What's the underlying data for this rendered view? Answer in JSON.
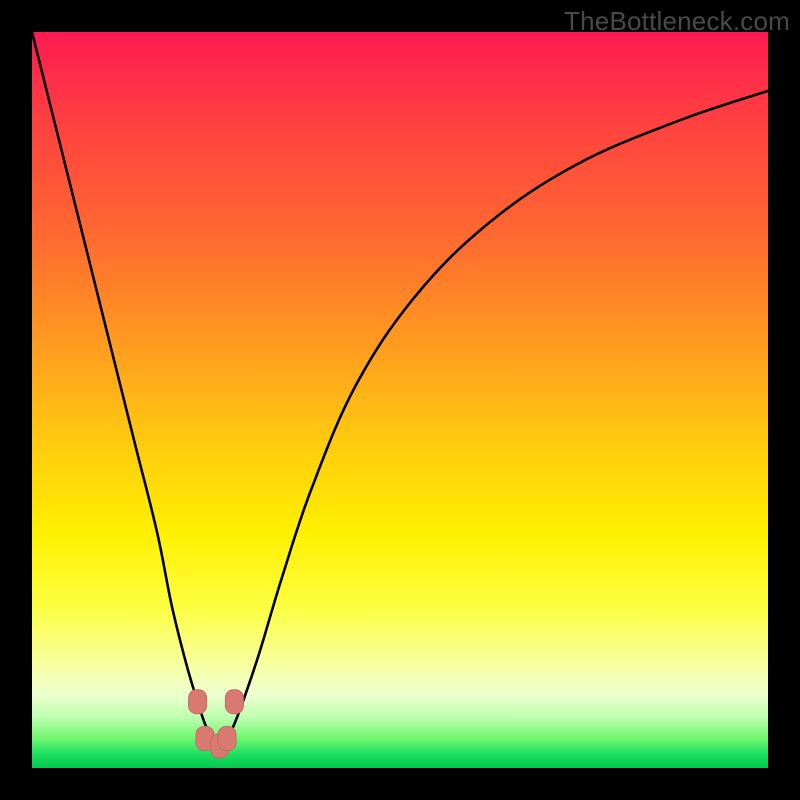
{
  "watermark": {
    "text": "TheBottleneck.com"
  },
  "colors": {
    "curve_stroke": "#000000",
    "marker_fill": "#d97a72",
    "marker_stroke": "#c86a62"
  },
  "chart_data": {
    "type": "line",
    "title": "",
    "xlabel": "",
    "ylabel": "",
    "xlim": [
      0,
      100
    ],
    "ylim": [
      0,
      100
    ],
    "grid": false,
    "legend": false,
    "series": [
      {
        "name": "bottleneck-curve",
        "x": [
          0,
          2,
          5,
          8,
          11,
          14,
          17,
          19,
          21,
          22.5,
          23.5,
          24.5,
          25.5,
          26.5,
          27.5,
          29,
          31,
          34,
          38,
          44,
          52,
          62,
          74,
          88,
          100
        ],
        "y": [
          100,
          92,
          80,
          68,
          56,
          44,
          32,
          22,
          14,
          9,
          6,
          4,
          3,
          4,
          6,
          10,
          16,
          26,
          38,
          52,
          64,
          74,
          82,
          88,
          92
        ]
      }
    ],
    "markers": [
      {
        "x": 22.5,
        "y": 9
      },
      {
        "x": 23.5,
        "y": 4
      },
      {
        "x": 25.5,
        "y": 3
      },
      {
        "x": 26.5,
        "y": 4
      },
      {
        "x": 27.5,
        "y": 9
      }
    ]
  }
}
